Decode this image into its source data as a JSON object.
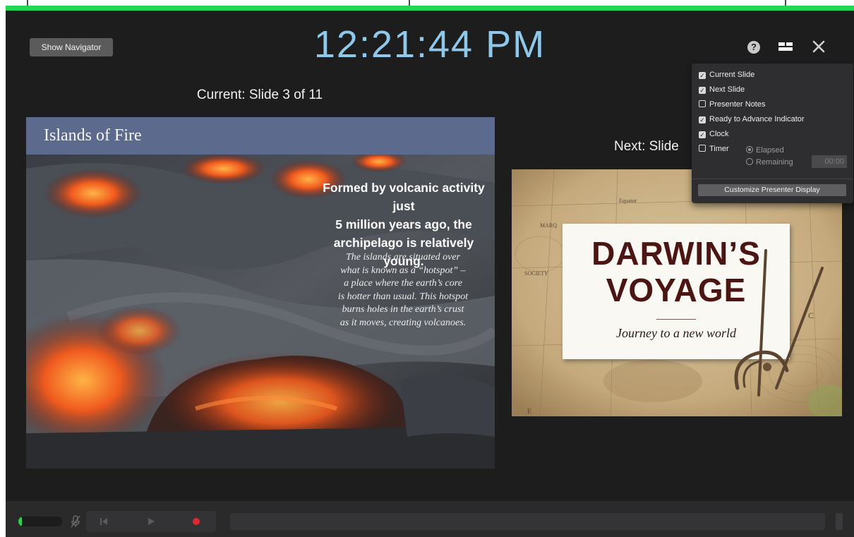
{
  "header": {
    "show_navigator_label": "Show Navigator",
    "clock": "12:21:44 PM"
  },
  "current": {
    "label": "Current: Slide 3 of 11",
    "slide": {
      "title": "Islands of Fire",
      "heading_lines": [
        "Formed by volcanic activity just",
        "5 million years ago, the",
        "archipelago is relatively young."
      ],
      "body_lines": [
        "The islands are situated over",
        "what is known as a “hotspot” –",
        "a place where the earth’s core",
        "is hotter than usual. This hotspot",
        "burns holes in the earth’s crust",
        "as it moves, creating volcanoes."
      ]
    }
  },
  "next": {
    "label": "Next: Slide",
    "slide": {
      "title_lines": [
        "DARWIN’S",
        "VOYAGE"
      ],
      "subtitle": "Journey to a new world",
      "map_labels": {
        "equator": "Equator",
        "society": "SOCIETY",
        "marquesas": "MARQ",
        "c": "C",
        "e": "E"
      }
    }
  },
  "options_menu": {
    "items": [
      {
        "label": "Current Slide",
        "checked": true
      },
      {
        "label": "Next Slide",
        "checked": true
      },
      {
        "label": "Presenter Notes",
        "checked": false
      },
      {
        "label": "Ready to Advance Indicator",
        "checked": true
      },
      {
        "label": "Clock",
        "checked": true
      },
      {
        "label": "Timer",
        "checked": false
      }
    ],
    "timer_modes": [
      {
        "label": "Elapsed",
        "selected": true
      },
      {
        "label": "Remaining",
        "selected": false
      }
    ],
    "timer_value": "00:00",
    "customize_label": "Customize Presenter Display"
  },
  "toolbar": {
    "audio_level": 0.08
  },
  "icons": {
    "help": "help-icon",
    "layout": "layout-icon",
    "close": "close-icon",
    "mic": "mic-muted-icon",
    "rewind": "rewind-icon",
    "play": "play-icon",
    "record": "record-icon"
  },
  "colors": {
    "ready_indicator": "#1fd755",
    "clock": "#8fc8ea",
    "record": "#e2262f",
    "slide_header": "#5c6b8d"
  }
}
